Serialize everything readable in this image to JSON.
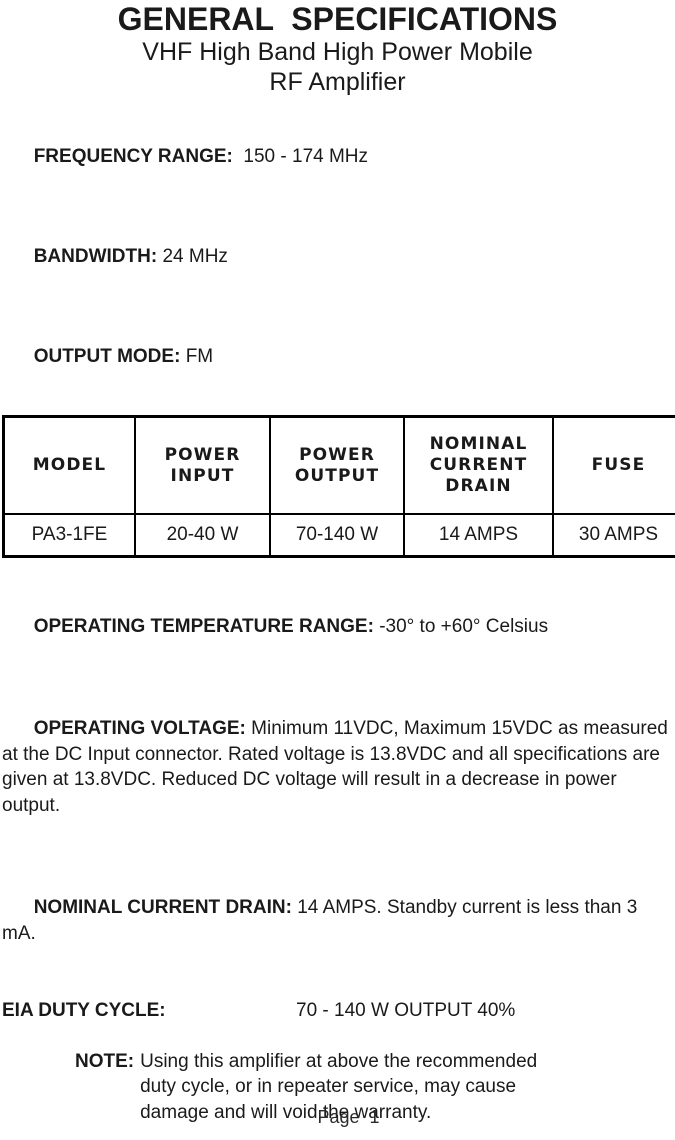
{
  "document": {
    "title": "GENERAL  SPECIFICATIONS",
    "subtitle_line1": "VHF High Band High Power Mobile",
    "subtitle_line2": "RF Amplifier"
  },
  "specs": [
    {
      "label": "FREQUENCY RANGE: ",
      "value": " 150 - 174 MHz"
    },
    {
      "label": "BANDWIDTH: ",
      "value": "24 MHz"
    },
    {
      "label": "OUTPUT MODE: ",
      "value": "FM"
    }
  ],
  "table": {
    "headers": [
      "MODEL",
      "POWER\nINPUT",
      "POWER\nOUTPUT",
      "NOMINAL\nCURRENT\nDRAIN",
      "FUSE"
    ],
    "rows": [
      [
        "PA3-1FE",
        "20-40 W",
        "70-140 W",
        "14 AMPS",
        "30 AMPS"
      ]
    ]
  },
  "details": [
    {
      "label": "OPERATING TEMPERATURE RANGE: ",
      "value": "-30° to +60° Celsius"
    },
    {
      "label": "OPERATING VOLTAGE: ",
      "value": "Minimum 11VDC, Maximum 15VDC as measured at the DC Input connector. Rated voltage is 13.8VDC and all specifications are given at 13.8VDC. Reduced DC voltage will result in a decrease in power output."
    },
    {
      "label": "NOMINAL CURRENT DRAIN: ",
      "value": "14 AMPS. Standby current is less than 3 mA."
    }
  ],
  "duty_cycle": {
    "label": "EIA DUTY CYCLE:",
    "value": "70 - 140 W OUTPUT 40%"
  },
  "note": {
    "label": "NOTE:",
    "text": "Using this amplifier at above the recommended\nduty cycle, or in repeater service, may cause\ndamage and will void the warranty."
  },
  "footer": {
    "page_label": "Page  1"
  },
  "colors": {
    "text": "#1a1a1a",
    "rule": "#000000",
    "background": "#ffffff"
  }
}
